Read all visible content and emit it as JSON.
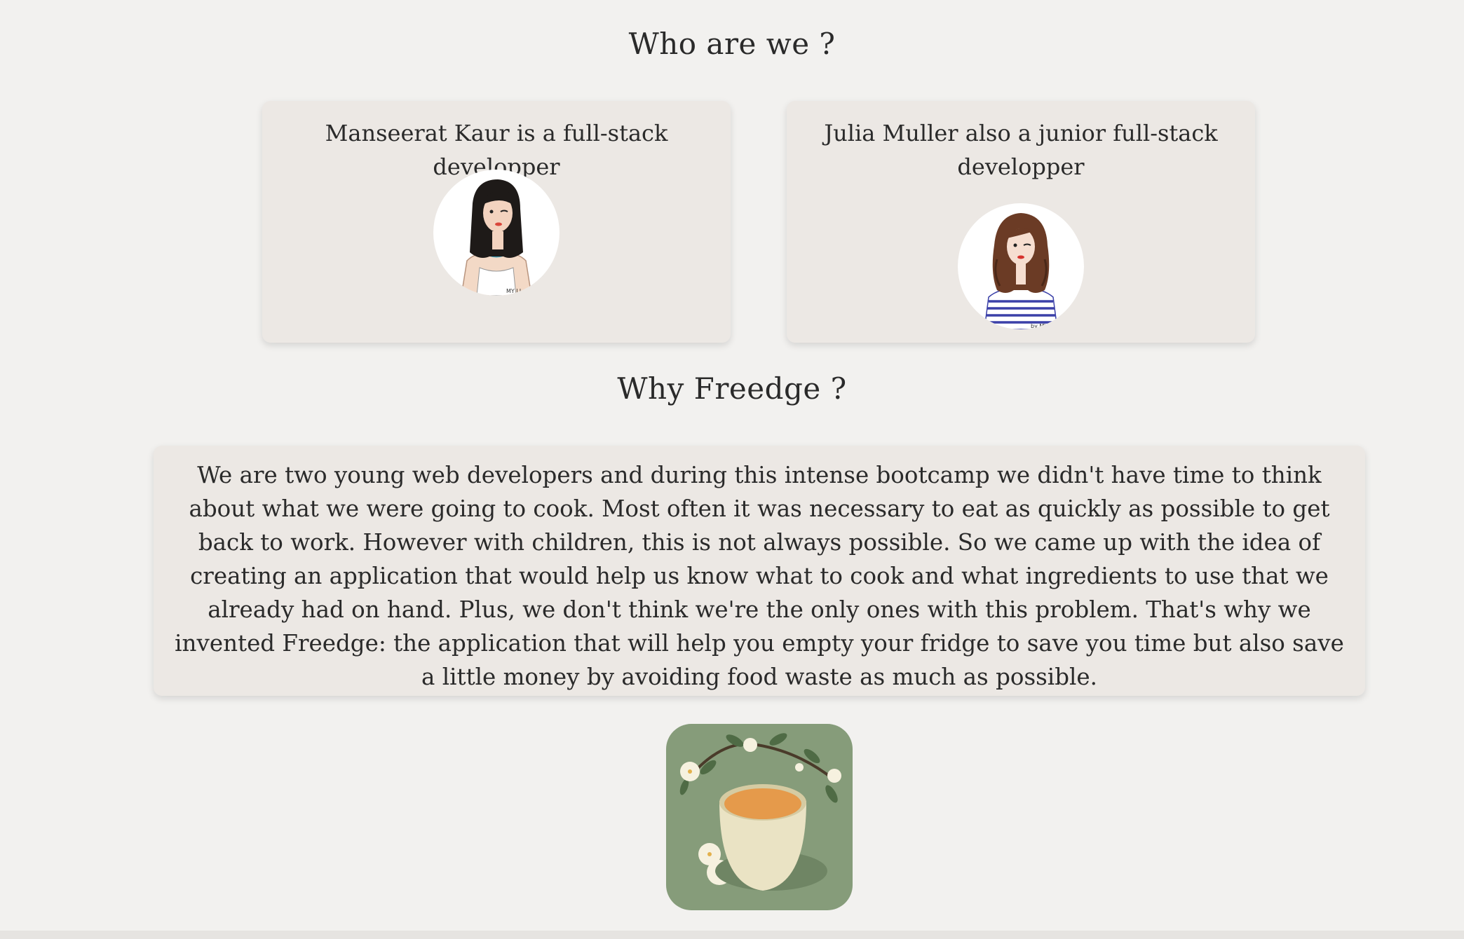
{
  "who_section": {
    "title": "Who are we ?"
  },
  "team": [
    {
      "caption": "Manseerat Kaur is a full-stack developper",
      "avatar_icon": "woman-black-hair-portrait"
    },
    {
      "caption": "Julia Muller also a junior full-stack developper",
      "avatar_icon": "woman-brown-hair-striped-shirt-portrait"
    }
  ],
  "why_section": {
    "title": "Why Freedge ?",
    "text": "We are two young web developers and during this intense bootcamp we didn't have time to think about what we were going to cook. Most often it was necessary to eat as quickly as possible to get back to work. However with children, this is not always possible. So we came up with the idea of creating an application that would help us know what to cook and what ingredients to use that we already had on hand. Plus, we don't think we're the only ones with this problem. That's why we invented Freedge: the application that will help you empty your fridge to save you time but also save a little money by avoiding food waste as much as possible."
  },
  "illustration": {
    "icon": "tea-cup-with-flowers",
    "background_color": "#869c7a"
  },
  "colors": {
    "page_background": "#f2f1ef",
    "card_background": "#ece8e4",
    "text": "#2a2a2a"
  }
}
